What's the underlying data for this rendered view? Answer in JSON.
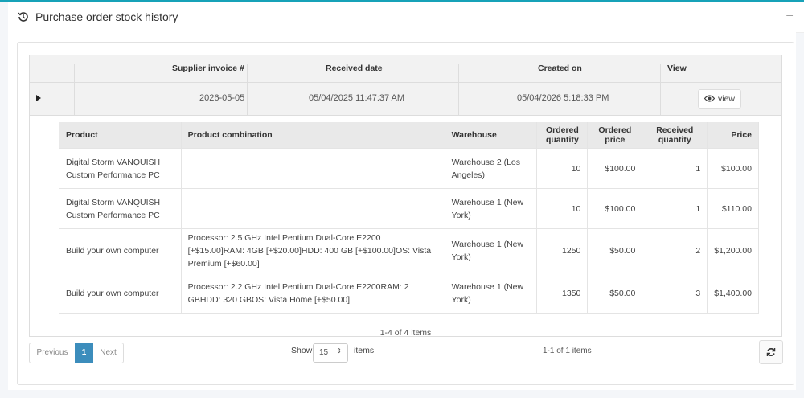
{
  "header": {
    "title": "Purchase order stock history",
    "collapse_symbol": "–"
  },
  "grid": {
    "columns": [
      "Supplier invoice #",
      "Received date",
      "Created on",
      "View"
    ],
    "master_row": {
      "supplier_invoice": "2026-05-05",
      "received_date": "05/04/2025 11:47:37 AM",
      "created_on": "05/04/2026 5:18:33 PM",
      "view_label": "view"
    },
    "detail": {
      "columns": {
        "product": "Product",
        "combination": "Product combination",
        "warehouse": "Warehouse",
        "ordered_qty_1": "Ordered",
        "ordered_qty_2": "quantity",
        "ordered_price_1": "Ordered",
        "ordered_price_2": "price",
        "received_qty_1": "Received",
        "received_qty_2": "quantity",
        "price": "Price"
      },
      "rows": [
        {
          "product": "Digital Storm VANQUISH Custom Performance PC",
          "combination": "",
          "warehouse": "Warehouse 2 (Los Angeles)",
          "ordered_qty": "10",
          "ordered_price": "$100.00",
          "received_qty": "1",
          "price": "$100.00"
        },
        {
          "product": "Digital Storm VANQUISH Custom Performance PC",
          "combination": "",
          "warehouse": "Warehouse 1 (New York)",
          "ordered_qty": "10",
          "ordered_price": "$100.00",
          "received_qty": "1",
          "price": "$110.00"
        },
        {
          "product": "Build your own computer",
          "combination": "Processor: 2.5 GHz Intel Pentium Dual-Core E2200 [+$15.00]RAM: 4GB [+$20.00]HDD: 400 GB [+$100.00]OS: Vista Premium [+$60.00]",
          "warehouse": "Warehouse 1 (New York)",
          "ordered_qty": "1250",
          "ordered_price": "$50.00",
          "received_qty": "2",
          "price": "$1,200.00"
        },
        {
          "product": "Build your own computer",
          "combination": "Processor: 2.2 GHz Intel Pentium Dual-Core E2200RAM: 2 GBHDD: 320 GBOS: Vista Home [+$50.00]",
          "warehouse": "Warehouse 1 (New York)",
          "ordered_qty": "1350",
          "ordered_price": "$50.00",
          "received_qty": "3",
          "price": "$1,400.00"
        }
      ],
      "items_text": "1-4 of 4 items"
    }
  },
  "pager": {
    "previous": "Previous",
    "current": "1",
    "next": "Next",
    "show_label": "Show",
    "page_size": "15",
    "items_label": "items",
    "page_info": "1-1 of 1 items"
  },
  "colors": {
    "accent": "#3c8dbc",
    "top_border": "#17a2b8"
  },
  "icons": {
    "header": "history-icon",
    "view": "eye-icon",
    "refresh": "refresh-icon",
    "expand": "expand-triangle-icon"
  }
}
